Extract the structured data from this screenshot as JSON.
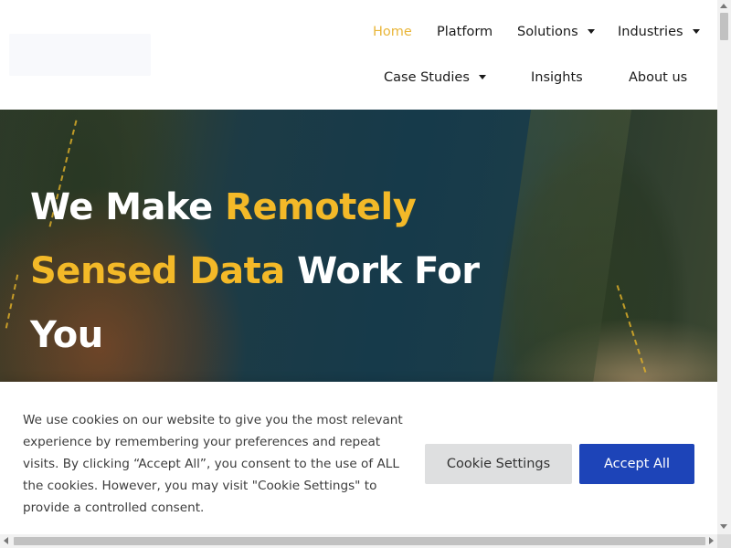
{
  "nav": {
    "items": [
      {
        "label": "Home",
        "active": true,
        "has_dropdown": false
      },
      {
        "label": "Platform",
        "active": false,
        "has_dropdown": false
      },
      {
        "label": "Solutions",
        "active": false,
        "has_dropdown": true
      },
      {
        "label": "Industries",
        "active": false,
        "has_dropdown": true
      },
      {
        "label": "Case Studies",
        "active": false,
        "has_dropdown": true
      },
      {
        "label": "Insights",
        "active": false,
        "has_dropdown": false
      },
      {
        "label": "About us",
        "active": false,
        "has_dropdown": false
      }
    ],
    "active_color": "#e9b63a",
    "dropdown_icon": "caret-down-icon"
  },
  "hero": {
    "title_part1": "We Make ",
    "title_highlight": "Remotely Sensed Data",
    "title_part2": " Work For You",
    "highlight_color": "#f3b928"
  },
  "cookie_banner": {
    "message": "We use cookies on our website to give you the most relevant experience by remembering your preferences and repeat visits. By clicking “Accept All”, you consent to the use of ALL the cookies. However, you may visit \"Cookie Settings\" to provide a controlled consent.",
    "settings_label": "Cookie Settings",
    "accept_label": "Accept All",
    "accept_color": "#1d44b8"
  }
}
